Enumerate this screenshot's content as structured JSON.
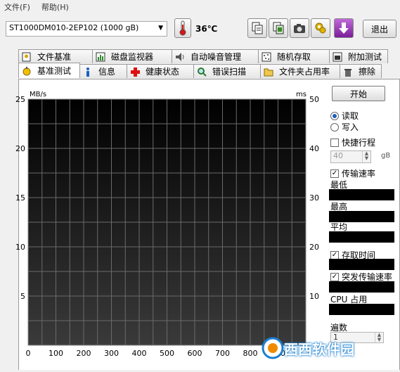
{
  "menu": {
    "file": "文件(F)",
    "help": "帮助(H)"
  },
  "toolbar": {
    "drive": "ST1000DM010-2EP102 (1000 gB)",
    "temperature": "36℃",
    "exit_label": "退出",
    "icons": [
      "copy-text-icon",
      "copy-info-icon",
      "screenshot-icon",
      "options-icon",
      "download-icon"
    ]
  },
  "tabs": {
    "row1": [
      "文件基准",
      "磁盘监视器",
      "自动噪音管理",
      "随机存取",
      "附加测试"
    ],
    "row2": [
      "基准测试",
      "信息",
      "健康状态",
      "错误扫描",
      "文件夹占用率",
      "擦除"
    ]
  },
  "side": {
    "start": "开始",
    "read": "读取",
    "write": "写入",
    "shortstroke": "快捷行程",
    "shortstroke_value": "40",
    "shortstroke_unit": "gB",
    "transfer_rate": "传输速率",
    "min": "最低",
    "max": "最高",
    "avg": "平均",
    "access_time": "存取时间",
    "burst_rate": "突发传输速率",
    "cpu": "CPU 占用",
    "passes": "遍数",
    "passes_value": "1"
  },
  "chart_data": {
    "type": "line",
    "left_unit": "MB/s",
    "right_unit": "ms",
    "y_ticks": [
      "25",
      "20",
      "15",
      "10",
      "5"
    ],
    "y2_ticks": [
      "50",
      "40",
      "30",
      "20",
      "10"
    ],
    "x_ticks": [
      "0",
      "100",
      "200",
      "300",
      "400",
      "500",
      "600",
      "700",
      "800",
      "900"
    ],
    "ylim": [
      0,
      25
    ],
    "y2lim": [
      0,
      50
    ],
    "xlim": [
      0,
      1000
    ],
    "grid": true,
    "series": []
  },
  "watermark": {
    "text": "西西软件园"
  },
  "colors": {
    "chart_bg_top": "#000000",
    "chart_bg_bottom": "#3a3a3a",
    "grid": "#6a6a6a",
    "accent": "#1a7fd0"
  }
}
